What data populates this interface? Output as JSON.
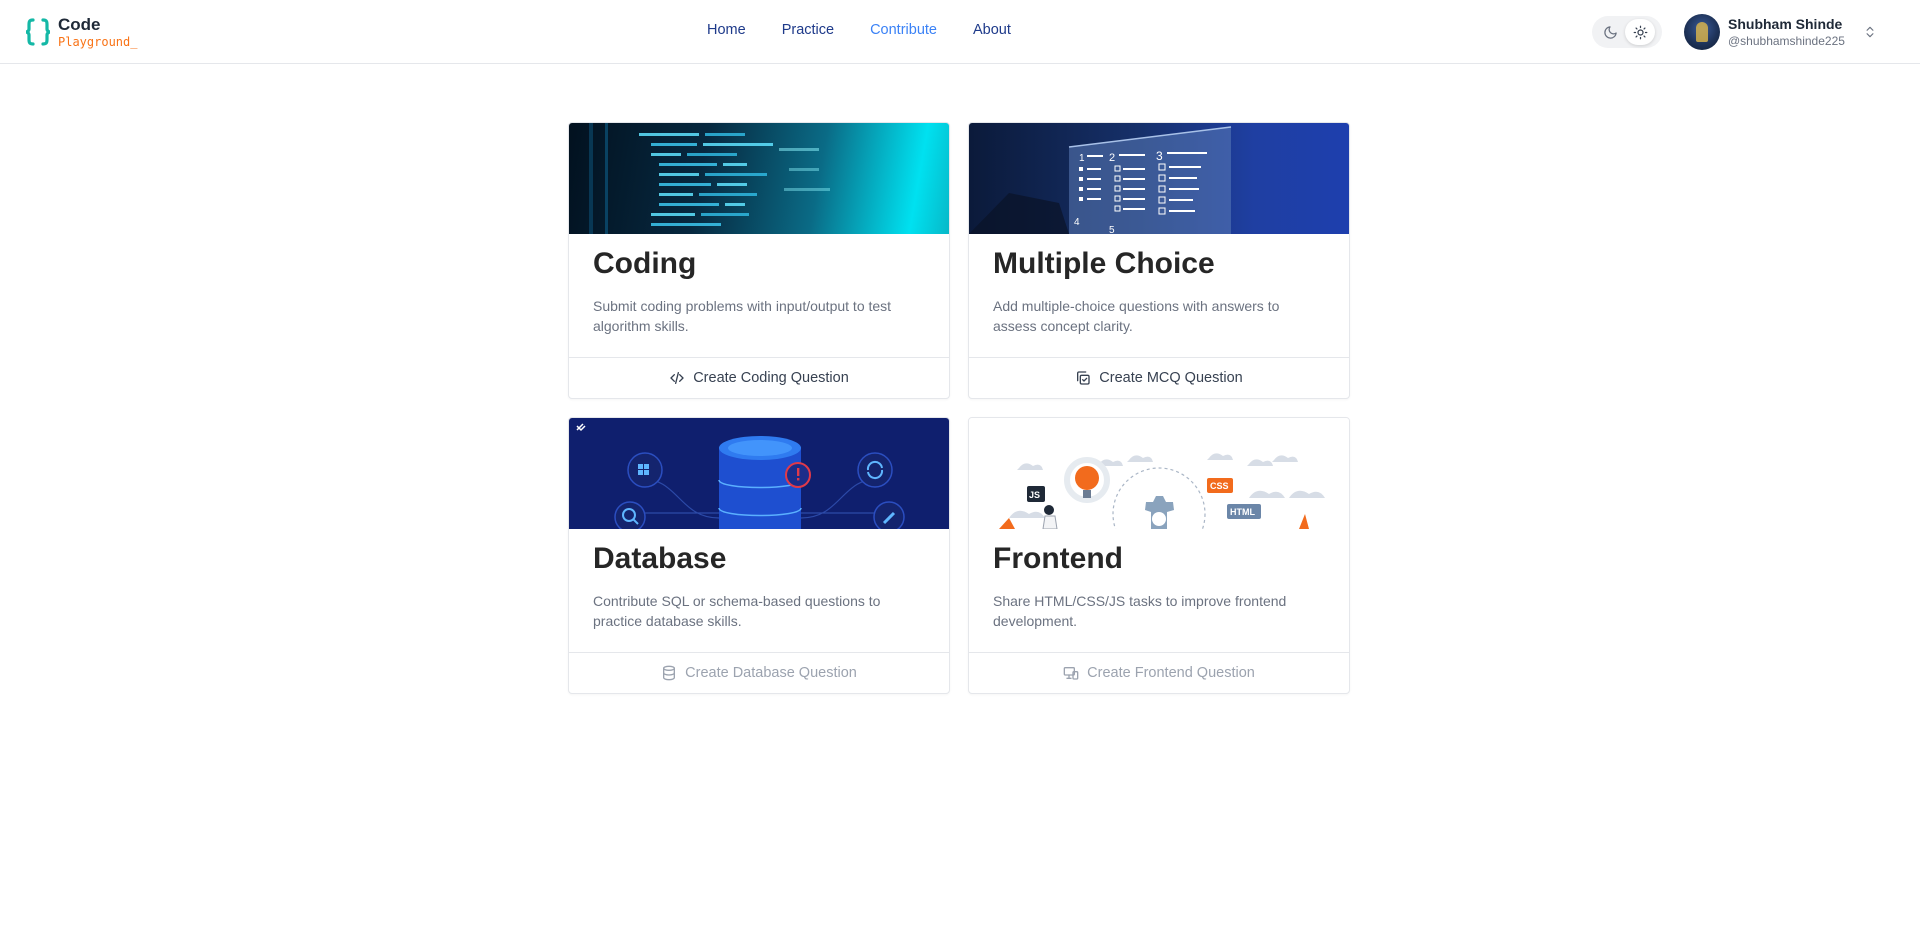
{
  "brand": {
    "title": "Code",
    "subtitle": "Playground_"
  },
  "nav": {
    "home": "Home",
    "practice": "Practice",
    "contribute": "Contribute",
    "about": "About"
  },
  "user": {
    "name": "Shubham Shinde",
    "handle": "@shubhamshinde225"
  },
  "theme": {
    "selected": "light"
  },
  "cards": [
    {
      "title": "Coding",
      "description": "Submit coding problems with input/output to test algorithm skills.",
      "action": "Create Coding Question",
      "icon": "code-icon",
      "enabled": true
    },
    {
      "title": "Multiple Choice",
      "description": "Add multiple-choice questions with answers to assess concept clarity.",
      "action": "Create MCQ Question",
      "icon": "copy-check-icon",
      "enabled": true
    },
    {
      "title": "Database",
      "description": "Contribute SQL or schema-based questions to practice database skills.",
      "action": "Create Database Question",
      "icon": "database-icon",
      "enabled": false
    },
    {
      "title": "Frontend",
      "description": "Share HTML/CSS/JS tasks to improve frontend development.",
      "action": "Create Frontend Question",
      "icon": "devices-icon",
      "enabled": false
    }
  ],
  "illustration_labels": {
    "js": "JS",
    "css": "CSS",
    "html": "HTML",
    "mcq_numbers": [
      "1",
      "2",
      "3",
      "4",
      "5"
    ]
  },
  "colors": {
    "accent": "#14b8a6",
    "brand_orange": "#f97316",
    "nav_active": "#3b82f6",
    "nav": "#1e3a8a"
  }
}
